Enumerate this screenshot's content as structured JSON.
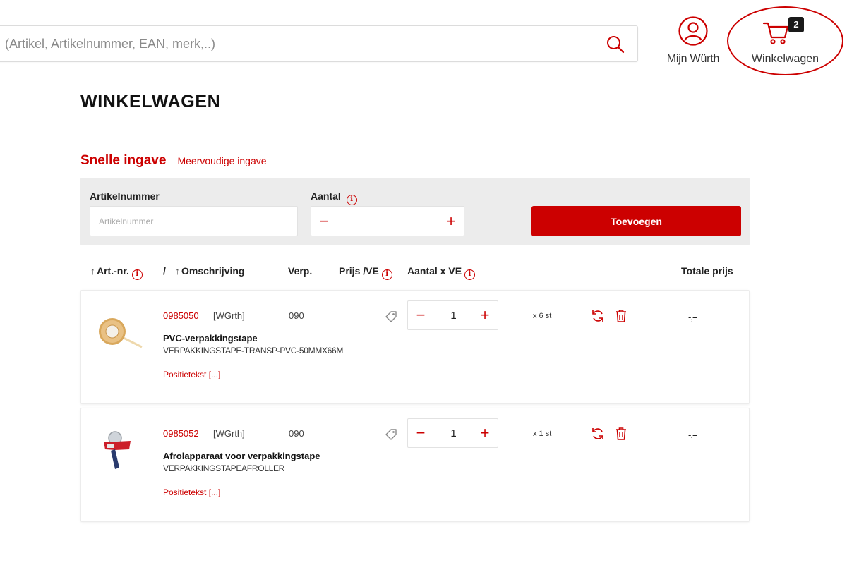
{
  "header": {
    "search_placeholder": "(Artikel, Artikelnummer, EAN, merk,..)",
    "account_label": "Mijn Würth",
    "cart_label": "Winkelwagen",
    "cart_count": "2"
  },
  "page": {
    "title": "WINKELWAGEN"
  },
  "entry": {
    "tab_quick": "Snelle ingave",
    "tab_multiple": "Meervoudige ingave",
    "article_label": "Artikelnummer",
    "article_placeholder": "Artikelnummer",
    "qty_label": "Aantal",
    "minus": "−",
    "plus": "+",
    "add_button": "Toevoegen"
  },
  "table": {
    "col_artnr": "Art.-nr.",
    "separator": "/",
    "col_description": "Omschrijving",
    "col_verp": "Verp.",
    "col_price": "Prijs /VE",
    "col_qty": "Aantal x VE",
    "col_total": "Totale prijs",
    "sort_symbol": "↑",
    "info_symbol": "i"
  },
  "items": [
    {
      "artnr": "0985050",
      "brand": "[WGrth]",
      "verp": "090",
      "title": "PVC-verpakkingstape",
      "description": "VERPAKKINGSTAPE-TRANSP-PVC-50MMX66M",
      "pos_text": "Positietekst [...]",
      "qty": "1",
      "per_unit": "x 6 st",
      "total": "-,--"
    },
    {
      "artnr": "0985052",
      "brand": "[WGrth]",
      "verp": "090",
      "title": "Afrolapparaat voor verpakkingstape",
      "description": "VERPAKKINGSTAPEAFROLLER",
      "pos_text": "Positietekst [...]",
      "qty": "1",
      "per_unit": "x 1 st",
      "total": "-,--"
    }
  ],
  "colors": {
    "accent": "#cc0000",
    "panel": "#ececec"
  },
  "icons": [
    "search-icon",
    "user-icon",
    "cart-icon",
    "info-icon",
    "tag-icon",
    "refresh-icon",
    "trash-icon",
    "tape-product-image",
    "dispenser-product-image"
  ]
}
